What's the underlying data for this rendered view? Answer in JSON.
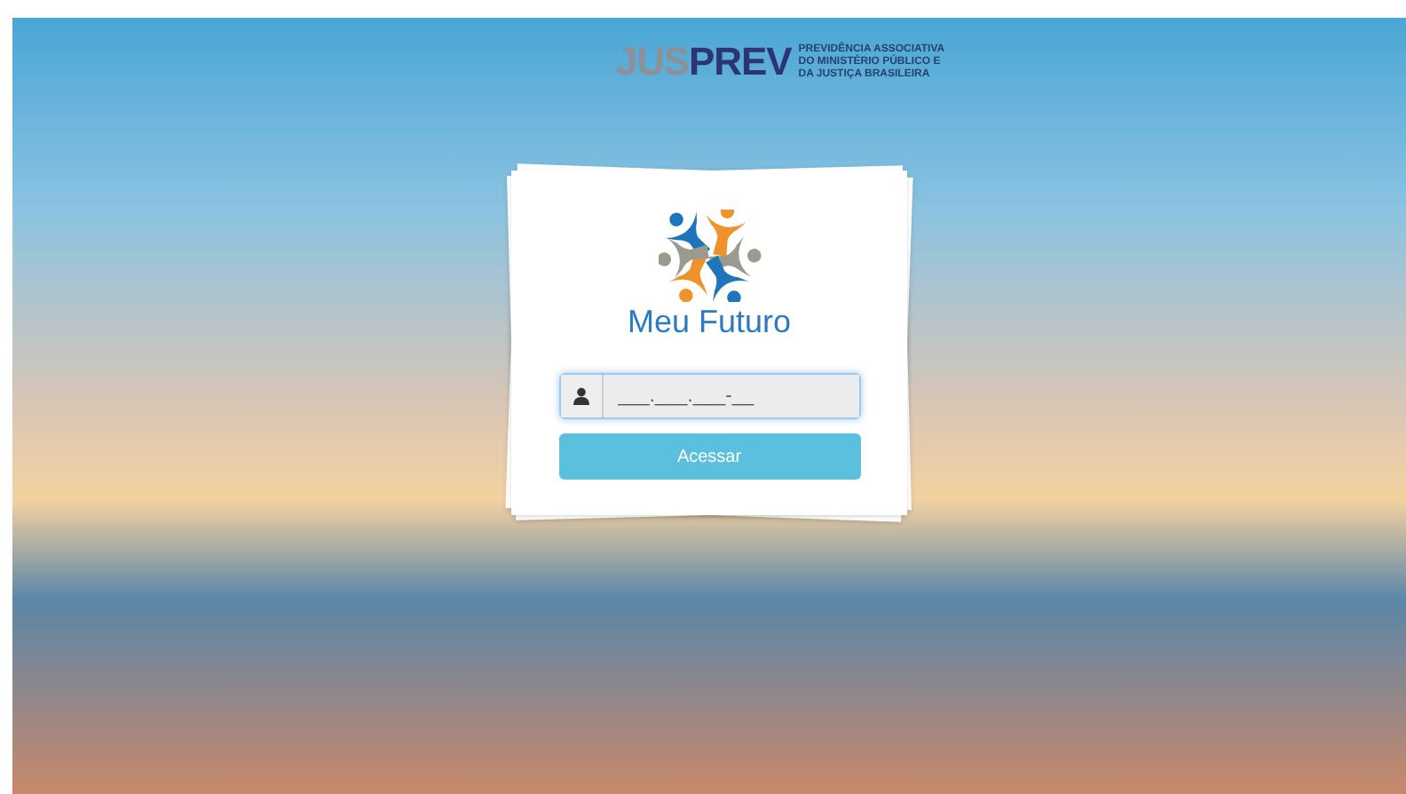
{
  "header_logo": {
    "part_1": "JUS",
    "part_2": "PREV",
    "tagline": [
      "PREVIDÊNCIA ASSOCIATIVA",
      "DO MINISTÉRIO PÚBLICO E",
      "DA JUSTIÇA BRASILEIRA"
    ]
  },
  "login_card": {
    "brand": "Meu Futuro",
    "cpf_field": {
      "value": "___.___.___-__",
      "focused": true
    },
    "submit_button": "Acessar"
  }
}
